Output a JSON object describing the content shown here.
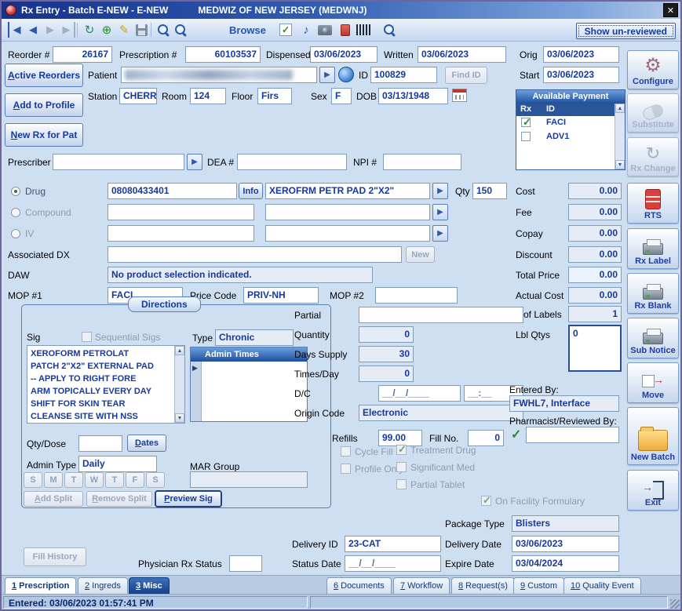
{
  "window": {
    "title": "Rx Entry - Batch E-NEW - E-NEW",
    "org": "MEDWIZ OF NEW JERSEY (MEDWNJ)",
    "close": "✕"
  },
  "toolbar": {
    "browse": "Browse",
    "show_unreviewed": "Show un-reviewed"
  },
  "header": {
    "reorder_label": "Reorder #",
    "reorder_value": "26167",
    "prescription_label": "Prescription #",
    "prescription_value": "60103537",
    "dispensed_label": "Dispensed",
    "dispensed_value": "03/06/2023",
    "written_label": "Written",
    "written_value": "03/06/2023",
    "orig_label": "Orig",
    "orig_value": "03/06/2023",
    "start_label": "Start",
    "start_value": "03/06/2023"
  },
  "left_nav": {
    "active_reorders": "Active Reorders",
    "add_to_profile": "Add to Profile",
    "new_rx_for_pat": "New Rx for Pat"
  },
  "patient": {
    "label": "Patient",
    "id_label": "ID",
    "id_value": "100829",
    "find_id": "Find ID",
    "station_label": "Station",
    "station_value": "CHERR",
    "room_label": "Room",
    "room_value": "124",
    "floor_label": "Floor",
    "floor_value": "Firs",
    "sex_label": "Sex",
    "sex_value": "F",
    "dob_label": "DOB",
    "dob_value": "03/13/1948"
  },
  "payment": {
    "title": "Available Payment",
    "col_rx": "Rx",
    "col_id": "ID",
    "rows": [
      {
        "id": "FACI",
        "checked": true
      },
      {
        "id": "ADV1",
        "checked": false
      }
    ]
  },
  "prescriber": {
    "label": "Prescriber",
    "dea_label": "DEA #",
    "npi_label": "NPI #"
  },
  "drug": {
    "drug_label": "Drug",
    "compound_label": "Compound",
    "iv_label": "IV",
    "ndc": "08080433401",
    "info": "Info",
    "name": "XEROFRM PETR PAD 2\"X2\"",
    "qty_label": "Qty",
    "qty_value": "150",
    "assoc_dx_label": "Associated DX",
    "new_button": "New",
    "daw_label": "DAW",
    "daw_value": "No product selection indicated.",
    "mop1_label": "MOP #1",
    "mop1_value": "FACI",
    "price_code_label": "Price Code",
    "price_code_value": "PRIV-NH",
    "mop2_label": "MOP #2"
  },
  "money": {
    "cost_label": "Cost",
    "cost": "0.00",
    "fee_label": "Fee",
    "fee": "0.00",
    "copay_label": "Copay",
    "copay": "0.00",
    "discount_label": "Discount",
    "discount": "0.00",
    "total_price_label": "Total Price",
    "total_price": "0.00",
    "actual_cost_label": "Actual Cost",
    "actual_cost": "0.00",
    "labels_label": "# of Labels",
    "labels_count": "1",
    "lbl_qtys_label": "Lbl Qtys",
    "lbl_qty_value": "0"
  },
  "directions": {
    "title": "Directions",
    "sig_label": "Sig",
    "sequential_sigs": "Sequential Sigs",
    "type_label": "Type",
    "type_value": "Chronic",
    "sig_text": "XEROFORM PETROLAT\nPATCH 2\"X2\" EXTERNAL PAD\n-- APPLY TO RIGHT FORE\nARM TOPICALLY EVERY DAY\nSHIFT FOR SKIN TEAR\nCLEANSE SITE WITH NSS",
    "admin_times_title": "Admin Times",
    "qty_dose_label": "Qty/Dose",
    "dates_button": "Dates",
    "admin_type_label": "Admin Type",
    "admin_type_value": "Daily",
    "mar_group_label": "MAR Group",
    "days": [
      "S",
      "M",
      "T",
      "W",
      "T",
      "F",
      "S"
    ],
    "add_split": "Add Split",
    "remove_split": "Remove Split",
    "preview_sig": "Preview Sig"
  },
  "details": {
    "partial_label": "Partial",
    "quantity_label": "Quantity",
    "quantity_value": "0",
    "days_supply_label": "Days Supply",
    "days_supply_value": "30",
    "times_day_label": "Times/Day",
    "times_day_value": "0",
    "dc_label": "D/C",
    "dc_date": "__/__/____",
    "dc_time": "__:__",
    "origin_label": "Origin Code",
    "origin_value": "Electronic",
    "refills_label": "Refills",
    "refills_value": "99.00",
    "fill_no_label": "Fill No.",
    "fill_no_value": "0",
    "entered_by_label": "Entered By:",
    "entered_by_value": "FWHL7, Interface",
    "pharmacist_label": "Pharmacist/Reviewed By:"
  },
  "checks": {
    "cycle_fill": "Cycle Fill",
    "profile_only": "Profile Only",
    "treatment_drug": "Treatment Drug",
    "significant_med": "Significant Med",
    "partial_tablet": "Partial Tablet",
    "on_facility_formulary": "On Facility Formulary"
  },
  "delivery": {
    "package_type_label": "Package Type",
    "package_type_value": "Blisters",
    "delivery_id_label": "Delivery ID",
    "delivery_id_value": "23-CAT",
    "delivery_date_label": "Delivery Date",
    "delivery_date_value": "03/06/2023",
    "status_date_label": "Status Date",
    "status_date_value": "__/__/____",
    "expire_date_label": "Expire Date",
    "expire_date_value": "03/04/2024",
    "fill_history": "Fill History",
    "physician_rx_status_label": "Physician Rx Status"
  },
  "side_buttons": [
    {
      "label": "Configure",
      "enabled": true
    },
    {
      "label": "Substitute",
      "enabled": false
    },
    {
      "label": "Rx Change",
      "enabled": false
    },
    {
      "label": "RTS",
      "enabled": true
    },
    {
      "label": "Rx Label",
      "enabled": true
    },
    {
      "label": "Rx Blank",
      "enabled": true
    },
    {
      "label": "Sub Notice",
      "enabled": true
    },
    {
      "label": "Move",
      "enabled": true
    },
    {
      "label": "New Batch",
      "enabled": true
    },
    {
      "label": "Exit",
      "enabled": true
    }
  ],
  "tabs": {
    "left": [
      {
        "num": "1",
        "label": "Prescription"
      },
      {
        "num": "2",
        "label": "Ingreds"
      },
      {
        "num": "3",
        "label": "Misc"
      }
    ],
    "right": [
      {
        "num": "6",
        "label": "Documents"
      },
      {
        "num": "7",
        "label": "Workflow"
      },
      {
        "num": "8",
        "label": "Request(s)"
      },
      {
        "num": "9",
        "label": "Custom"
      },
      {
        "num": "10",
        "label": "Quality Event"
      }
    ]
  },
  "statusbar": {
    "entered": "Entered: 03/06/2023 01:57:41 PM"
  }
}
